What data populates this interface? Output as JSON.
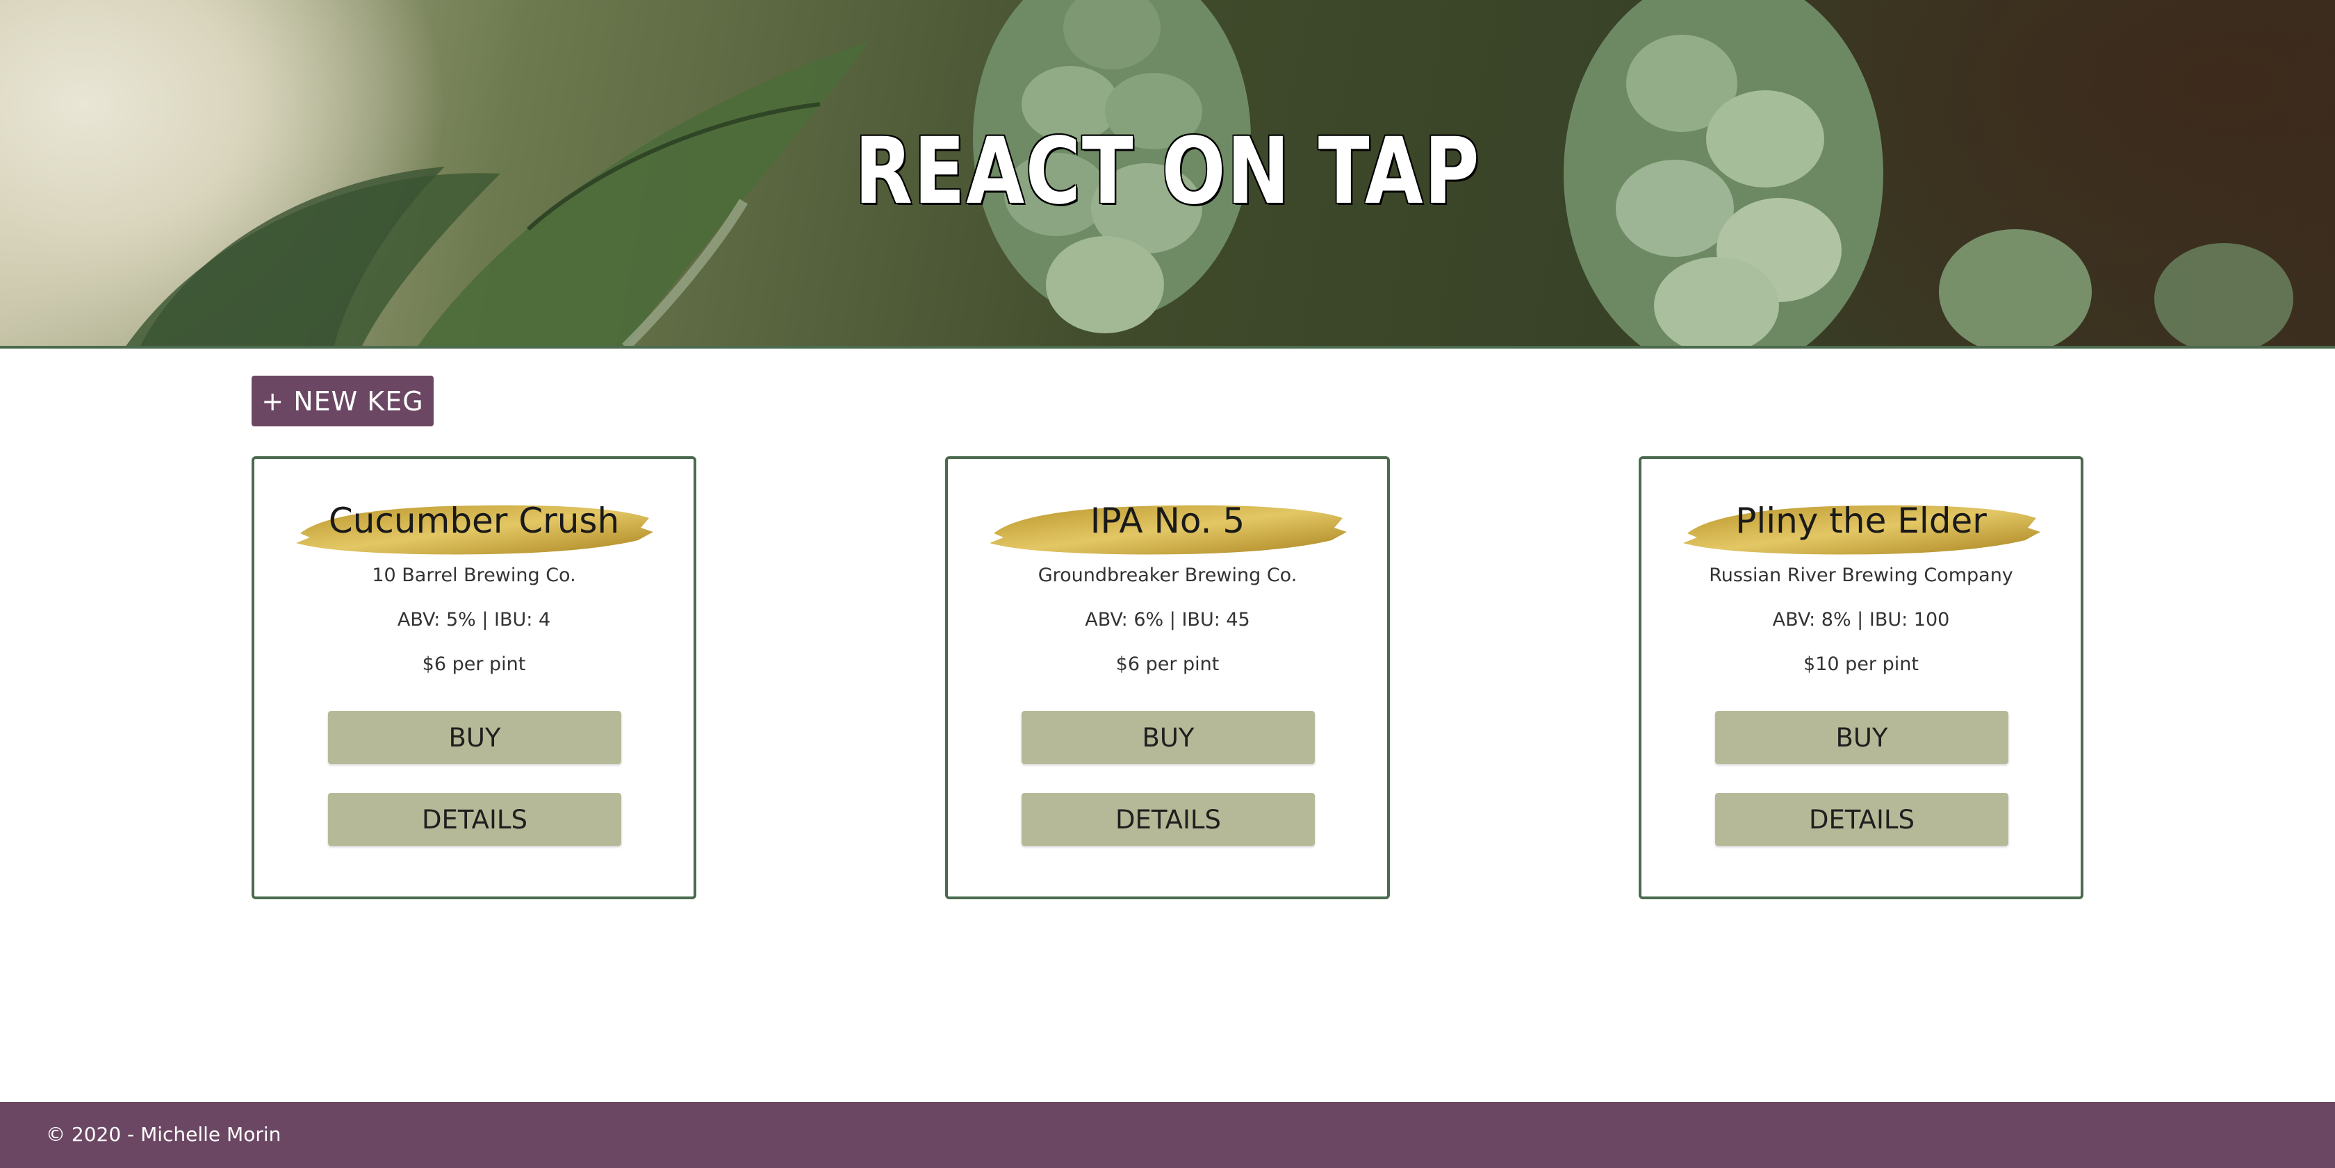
{
  "header": {
    "title": "REACT ON TAP"
  },
  "actions": {
    "new_keg_label": "+ NEW KEG"
  },
  "kegs": [
    {
      "name": "Cucumber Crush",
      "brewery": "10 Barrel Brewing Co.",
      "stats": "ABV: 5% | IBU: 4",
      "price": "$6 per pint",
      "buy_label": "BUY",
      "details_label": "DETAILS"
    },
    {
      "name": "IPA No. 5",
      "brewery": "Groundbreaker Brewing Co.",
      "stats": "ABV: 6% | IBU: 45",
      "price": "$6 per pint",
      "buy_label": "BUY",
      "details_label": "DETAILS"
    },
    {
      "name": "Pliny the Elder",
      "brewery": "Russian River Brewing Company",
      "stats": "ABV: 8% | IBU: 100",
      "price": "$10 per pint",
      "buy_label": "BUY",
      "details_label": "DETAILS"
    }
  ],
  "footer": {
    "copyright": "© 2020 - Michelle Morin"
  },
  "colors": {
    "accent_purple": "#6b4763",
    "card_border_green": "#4b6b4e",
    "button_sage": "#b6b997",
    "brush_gold": "#c9a93a"
  }
}
